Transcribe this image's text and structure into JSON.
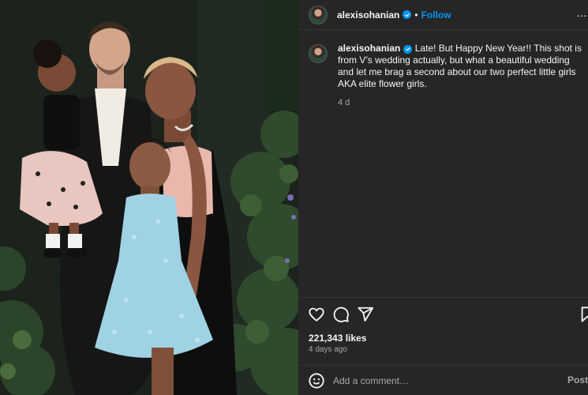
{
  "post": {
    "author": {
      "username": "alexisohanian",
      "verified": true,
      "avatar_icon": "profile-avatar"
    },
    "follow_label": "Follow",
    "separator": "•",
    "more_label": "…",
    "caption": {
      "text": "Late! But Happy New Year!! This shot is from V’s wedding actually, but what a beautiful wedding and let me brag a second about our two perfect little girls AKA elite flower girls.",
      "time": "4 d"
    },
    "likes": "221,343 likes",
    "date": "4 days ago",
    "comment": {
      "placeholder": "Add a comment…",
      "post_label": "Post"
    },
    "icons": [
      "heart-icon",
      "comment-icon",
      "share-icon",
      "bookmark-icon",
      "emoji-icon",
      "verified-badge-icon",
      "more-options-icon"
    ],
    "colors": {
      "accent": "#0095f6",
      "panel": "#262626",
      "text": "#f5f5f5",
      "muted": "#a8a8a8"
    }
  }
}
